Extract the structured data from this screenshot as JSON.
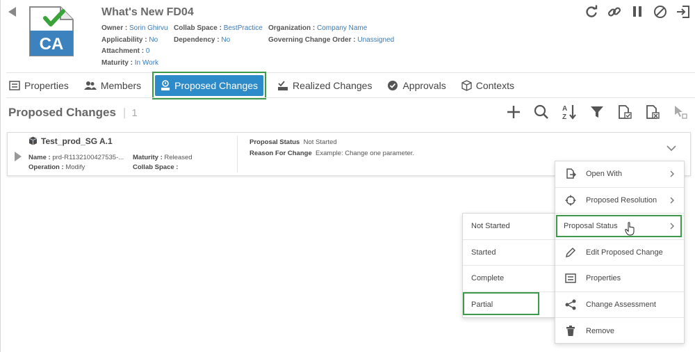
{
  "header": {
    "title": "What's New FD04",
    "badge_text": "CA",
    "owner_label": "Owner :",
    "owner": "Sorin Ghirvu",
    "collab_label": "Collab Space :",
    "collab": "BestPractice",
    "org_label": "Organization :",
    "org": "Company Name",
    "applicability_label": "Applicability :",
    "applicability": "No",
    "dependency_label": "Dependency :",
    "dependency": "No",
    "gco_label": "Governing Change Order :",
    "gco": "Unassigned",
    "attachment_label": "Attachment :",
    "attachment": "0",
    "maturity_label": "Maturity :",
    "maturity": "In Work"
  },
  "tabs": [
    {
      "label": "Properties",
      "icon": "properties-icon"
    },
    {
      "label": "Members",
      "icon": "members-icon"
    },
    {
      "label": "Proposed Changes",
      "icon": "proposed-changes-icon",
      "active": true
    },
    {
      "label": "Realized Changes",
      "icon": "realized-changes-icon"
    },
    {
      "label": "Approvals",
      "icon": "approvals-icon"
    },
    {
      "label": "Contexts",
      "icon": "contexts-icon"
    }
  ],
  "section": {
    "title": "Proposed Changes",
    "count": "1"
  },
  "card": {
    "name": "Test_prod_SG A.1",
    "name_label": "Name :",
    "name_value": "prd-R1132100427535-...",
    "maturity_label": "Maturity :",
    "maturity_value": "Released",
    "operation_label": "Operation :",
    "operation_value": "Modify",
    "collab_label": "Collab Space :",
    "collab_value": "",
    "status_label": "Proposal Status",
    "status_value": "Not Started",
    "reason_label": "Reason For Change",
    "reason_value": "Example: Change one parameter."
  },
  "context_menu": [
    {
      "label": "Open With",
      "icon": "open-with-icon",
      "submenu": true
    },
    {
      "label": "Proposed Resolution",
      "icon": "proposed-resolution-icon",
      "submenu": true
    },
    {
      "label": "Proposal Status",
      "icon": "",
      "submenu": true,
      "highlighted": true
    },
    {
      "label": "Edit Proposed Change",
      "icon": "pencil-icon",
      "submenu": false
    },
    {
      "label": "Properties",
      "icon": "properties-icon",
      "submenu": false
    },
    {
      "label": "Change Assessment",
      "icon": "share-icon",
      "submenu": false
    },
    {
      "label": "Remove",
      "icon": "trash-icon",
      "submenu": false
    }
  ],
  "status_submenu": [
    {
      "label": "Not Started"
    },
    {
      "label": "Started"
    },
    {
      "label": "Complete"
    },
    {
      "label": "Partial",
      "highlighted": true
    }
  ],
  "colors": {
    "accent": "#2e8bc9",
    "highlight": "#3d9a4a",
    "link": "#3b7ab7",
    "check_green": "#3aa33a"
  }
}
